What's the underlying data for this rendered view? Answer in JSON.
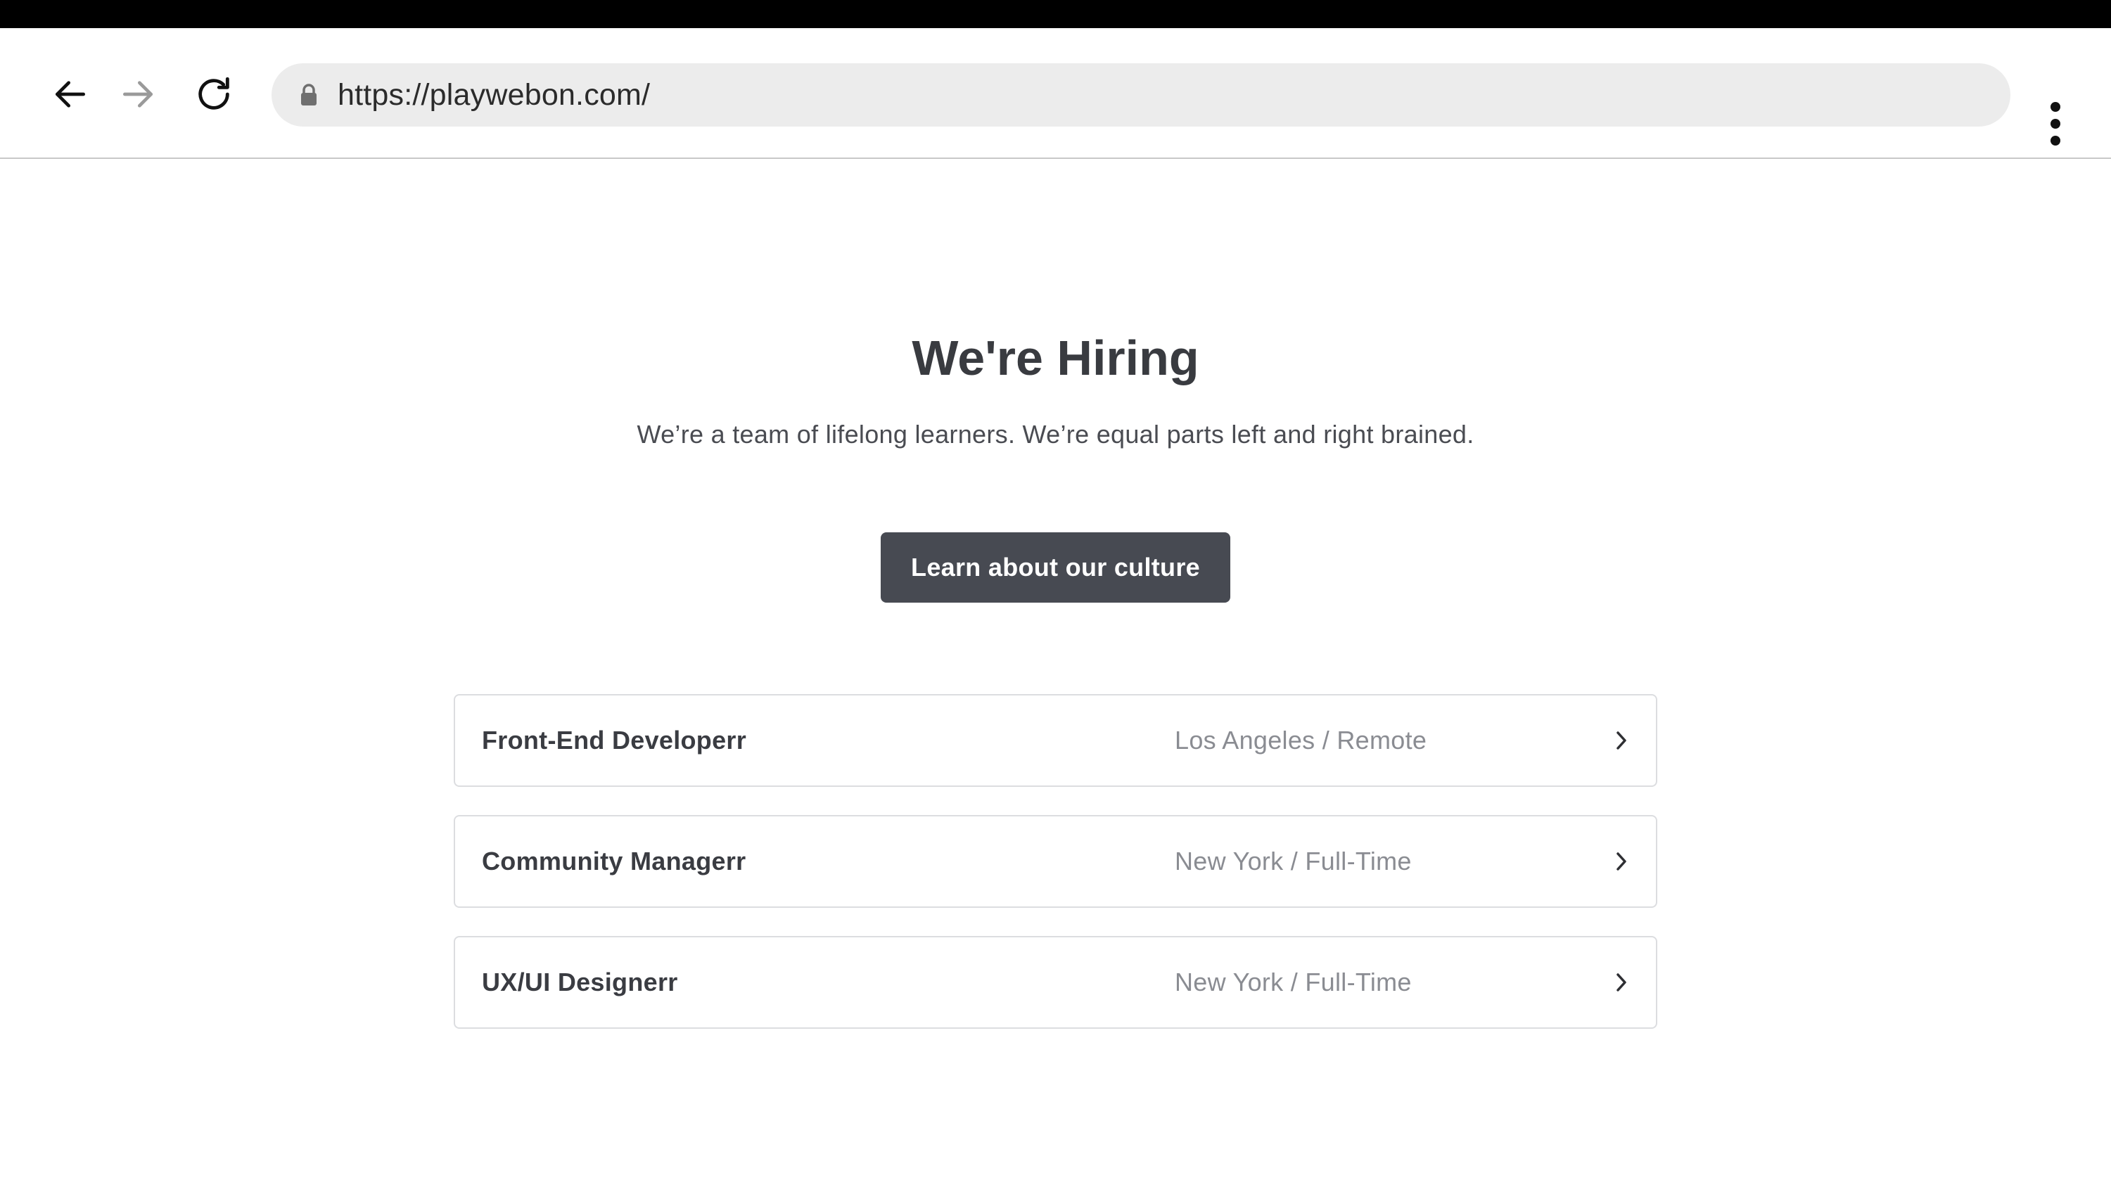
{
  "browser": {
    "url": "https://playwebon.com/",
    "icons": {
      "back": "arrow-left-icon",
      "forward": "arrow-right-icon",
      "reload": "reload-icon",
      "lock": "lock-icon",
      "menu": "vertical-dots-icon"
    }
  },
  "hero": {
    "title": "We're Hiring",
    "subtitle": "We’re a team of lifelong learners. We’re equal parts left and right brained.",
    "button_label": "Learn about our culture"
  },
  "jobs": [
    {
      "title": "Front-End Developerr",
      "location": "Los Angeles / Remote"
    },
    {
      "title": "Community Managerr",
      "location": "New York / Full-Time"
    },
    {
      "title": "UX/UI Designerr",
      "location": "New York / Full-Time"
    }
  ],
  "colors": {
    "button_bg": "#474a52",
    "title_text": "#393b40",
    "location_text": "#8a8c92",
    "address_bar_bg": "#ececec"
  }
}
